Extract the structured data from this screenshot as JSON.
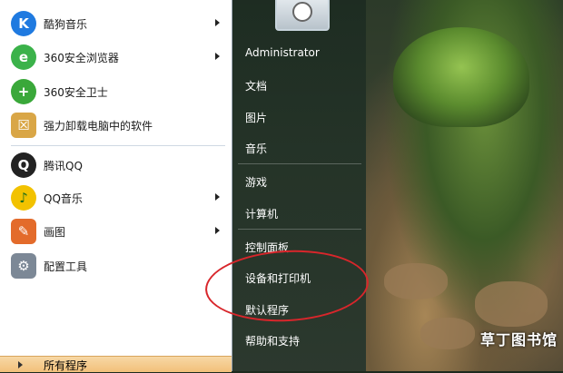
{
  "left_programs": [
    {
      "label": "酷狗音乐",
      "icon": "kugou-icon",
      "has_submenu": true
    },
    {
      "label": "360安全浏览器",
      "icon": "360-browser-icon",
      "has_submenu": true
    },
    {
      "label": "360安全卫士",
      "icon": "360-safe-icon",
      "has_submenu": false
    },
    {
      "label": "强力卸载电脑中的软件",
      "icon": "uninstall-icon",
      "has_submenu": false
    },
    {
      "label": "腾讯QQ",
      "icon": "qq-icon",
      "has_submenu": false
    },
    {
      "label": "QQ音乐",
      "icon": "qq-music-icon",
      "has_submenu": true
    },
    {
      "label": "画图",
      "icon": "paint-icon",
      "has_submenu": true
    },
    {
      "label": "配置工具",
      "icon": "config-tool-icon",
      "has_submenu": false
    }
  ],
  "all_programs_label": "所有程序",
  "right_items": {
    "user": "Administrator",
    "documents": "文档",
    "pictures": "图片",
    "music": "音乐",
    "games": "游戏",
    "computer": "计算机",
    "control_panel": "控制面板",
    "devices_printers": "设备和打印机",
    "default_programs": "默认程序",
    "help": "帮助和支持"
  },
  "watermark": "草丁图书馆"
}
